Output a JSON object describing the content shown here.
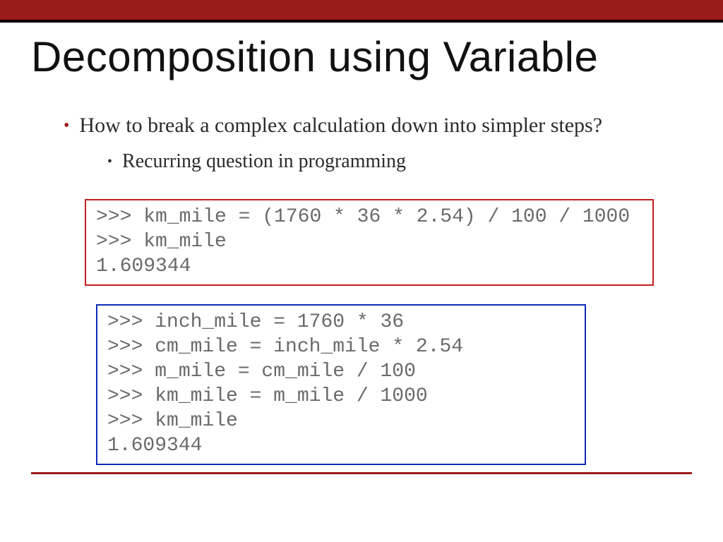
{
  "title": "Decomposition using Variable",
  "bullets": {
    "l1": "How to break a complex calculation down into simpler steps?",
    "l2": "Recurring question in programming"
  },
  "code_red": ">>> km_mile = (1760 * 36 * 2.54) / 100 / 1000\n>>> km_mile\n1.609344",
  "code_blue": ">>> inch_mile = 1760 * 36\n>>> cm_mile = inch_mile * 2.54\n>>> m_mile = cm_mile / 100\n>>> km_mile = m_mile / 1000\n>>> km_mile\n1.609344"
}
